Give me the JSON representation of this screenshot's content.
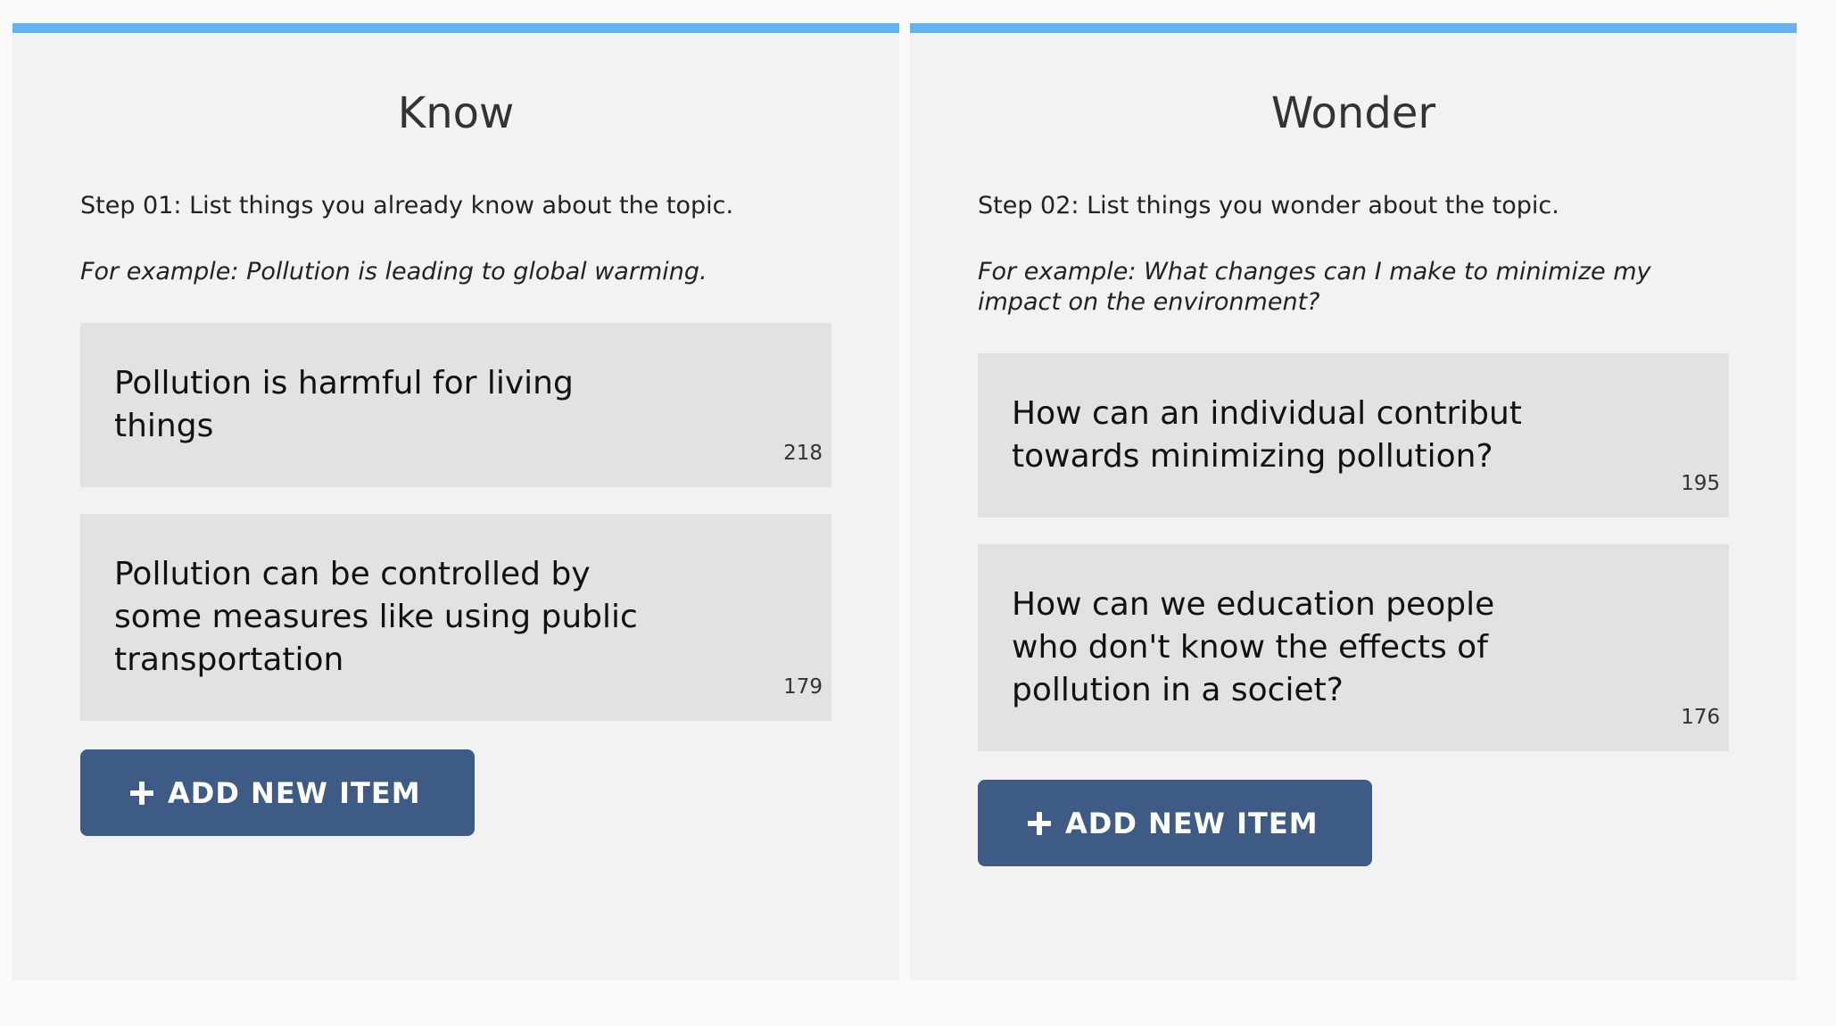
{
  "colors": {
    "panel_bg": "#f2f2f2",
    "accent_top_border": "#6cb0e8",
    "item_bg": "#e2e2e2",
    "button_bg": "#3e5b85"
  },
  "panels": [
    {
      "title": "Know",
      "step": "Step 01: List things you already know about the topic.",
      "example": "For example: Pollution is leading to global warming.",
      "items": [
        {
          "text": "Pollution is harmful for living things",
          "count": "218"
        },
        {
          "text": "Pollution can be controlled by some measures like using public transportation",
          "count": "179"
        }
      ],
      "button_label": "ADD NEW ITEM",
      "button_icon": "plus-icon"
    },
    {
      "title": "Wonder",
      "step": "Step 02: List things you wonder about the topic.",
      "example": "For example: What changes can I make to minimize my impact on the environment?",
      "items": [
        {
          "text": "How can an individual contribut towards minimizing pollution?",
          "count": "195"
        },
        {
          "text": "How can we education people who don't know the effects of pollution in a societ?",
          "count": "176"
        }
      ],
      "button_label": "ADD NEW ITEM",
      "button_icon": "plus-icon"
    }
  ]
}
